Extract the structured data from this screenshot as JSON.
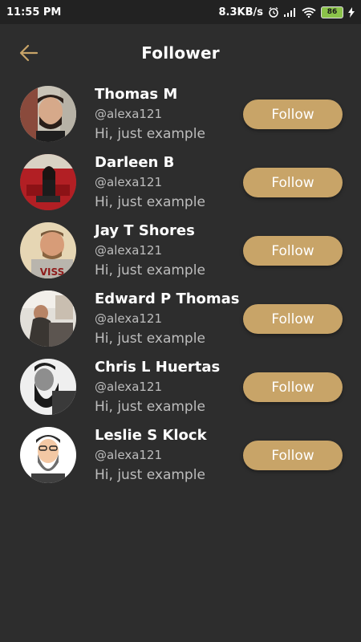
{
  "status_bar": {
    "time": "11:55 PM",
    "network_speed": "8.3KB/s",
    "battery": "86",
    "icons": [
      "alarm-icon",
      "signal-icon",
      "wifi-icon",
      "battery-icon",
      "charging-icon"
    ]
  },
  "header": {
    "title": "Follower",
    "back_icon": "arrow-left-icon"
  },
  "colors": {
    "background": "#2d2d2d",
    "accent": "#c8a468",
    "text_secondary": "#bdbdbd"
  },
  "followers": [
    {
      "name": "Thomas M",
      "handle": "@alexa121",
      "bio": "Hi, just example",
      "button": "Follow"
    },
    {
      "name": "Darleen B",
      "handle": "@alexa121",
      "bio": "Hi, just example",
      "button": "Follow"
    },
    {
      "name": "Jay T Shores",
      "handle": "@alexa121",
      "bio": "Hi, just example",
      "button": "Follow"
    },
    {
      "name": "Edward P Thomas",
      "handle": "@alexa121",
      "bio": "Hi, just example",
      "button": "Follow"
    },
    {
      "name": "Chris L Huertas",
      "handle": "@alexa121",
      "bio": "Hi, just example",
      "button": "Follow"
    },
    {
      "name": "Leslie S Klock",
      "handle": "@alexa121",
      "bio": "Hi, just example",
      "button": "Follow"
    }
  ]
}
